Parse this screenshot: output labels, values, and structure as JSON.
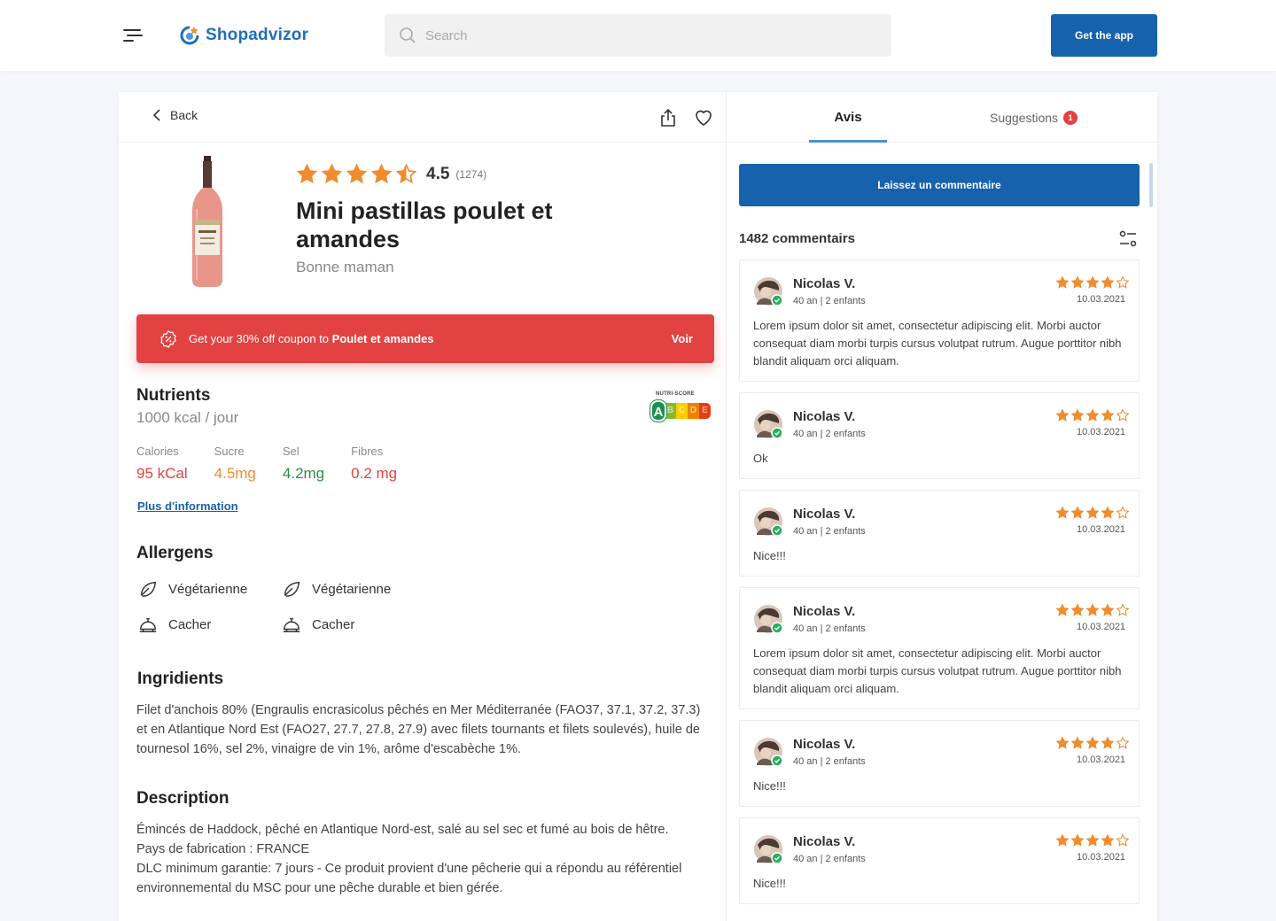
{
  "header": {
    "logo_text": "Shopadvizor",
    "search_placeholder": "Search",
    "get_app_label": "Get the app"
  },
  "product": {
    "back_label": "Back",
    "rating_value": "4.5",
    "rating_count": "(1274)",
    "rating_stars": 4.5,
    "title": "Mini pastillas poulet et amandes",
    "brand": "Bonne maman"
  },
  "coupon": {
    "text_prefix": "Get your 30% off coupon to ",
    "text_bold": "Poulet et amandes",
    "action_label": "Voir"
  },
  "nutrients": {
    "title": "Nutrients",
    "subtitle": "1000 kcal / jour",
    "nutri_score_label": "NUTRI-SCORE",
    "nutri_score_grade": "A",
    "nutri_score_letters": [
      "A",
      "B",
      "C",
      "D",
      "E"
    ],
    "items": [
      {
        "label": "Calories",
        "value": "95 kCal",
        "color": "#e24242"
      },
      {
        "label": "Sucre",
        "value": "4.5mg",
        "color": "#f08c2e"
      },
      {
        "label": "Sel",
        "value": "4.2mg",
        "color": "#2e8b3f"
      },
      {
        "label": "Fibres",
        "value": "0.2 mg",
        "color": "#e24242"
      }
    ],
    "more_link": "Plus d'information"
  },
  "allergens": {
    "title": "Allergens",
    "items": [
      {
        "label": "Végétarienne",
        "icon": "leaf-icon"
      },
      {
        "label": "Végétarienne",
        "icon": "leaf-icon"
      },
      {
        "label": "Cacher",
        "icon": "cloche-icon"
      },
      {
        "label": "Cacher",
        "icon": "cloche-icon"
      }
    ]
  },
  "ingredients": {
    "title": "Ingridients",
    "text": "Filet d'anchois 80% (Engraulis encrasicolus pêchés en Mer Méditerranée (FAO37, 37.1, 37.2, 37.3) et en Atlantique Nord Est (FAO27, 27.7, 27.8, 27.9) avec filets tournants et filets soulevés), huile de tournesol 16%, sel 2%, vinaigre de vin 1%, arôme d'escabèche 1%."
  },
  "description": {
    "title": "Description",
    "lines": [
      "Émincés de Haddock, pêché en Atlantique Nord-est, salé au sel sec et fumé au bois de hêtre.",
      "Pays de fabrication : FRANCE",
      "DLC minimum garantie: 7 jours - Ce produit provient d'une pêcherie qui a répondu au référentiel environnemental du MSC pour une pêche durable et bien gérée."
    ]
  },
  "reviews_panel": {
    "tab_reviews": "Avis",
    "tab_suggestions": "Suggestions",
    "suggestions_badge": "1",
    "leave_comment_label": "Laissez un commentaire",
    "count_label": "1482 commentairs",
    "reviews": [
      {
        "name": "Nicolas V.",
        "meta": "40 an | 2 enfants",
        "date": "10.03.2021",
        "stars": 4,
        "text": "Lorem ipsum dolor sit amet, consectetur adipiscing elit. Morbi auctor consequat diam morbi turpis cursus volutpat rutrum. Augue porttitor nibh blandit aliquam orci aliquam."
      },
      {
        "name": "Nicolas V.",
        "meta": "40 an | 2 enfants",
        "date": "10.03.2021",
        "stars": 4,
        "text": "Ok"
      },
      {
        "name": "Nicolas V.",
        "meta": "40 an | 2 enfants",
        "date": "10.03.2021",
        "stars": 4,
        "text": "Nice!!!"
      },
      {
        "name": "Nicolas V.",
        "meta": "40 an | 2 enfants",
        "date": "10.03.2021",
        "stars": 4,
        "text": "Lorem ipsum dolor sit amet, consectetur adipiscing elit. Morbi auctor consequat diam morbi turpis cursus volutpat rutrum. Augue porttitor nibh blandit aliquam orci aliquam."
      },
      {
        "name": "Nicolas V.",
        "meta": "40 an | 2 enfants",
        "date": "10.03.2021",
        "stars": 4,
        "text": "Nice!!!"
      },
      {
        "name": "Nicolas V.",
        "meta": "40 an | 2 enfants",
        "date": "10.03.2021",
        "stars": 4,
        "text": "Nice!!!"
      }
    ]
  },
  "colors": {
    "brand_blue": "#1762ad",
    "coupon_red": "#e24242",
    "star_orange": "#f08c2e"
  }
}
